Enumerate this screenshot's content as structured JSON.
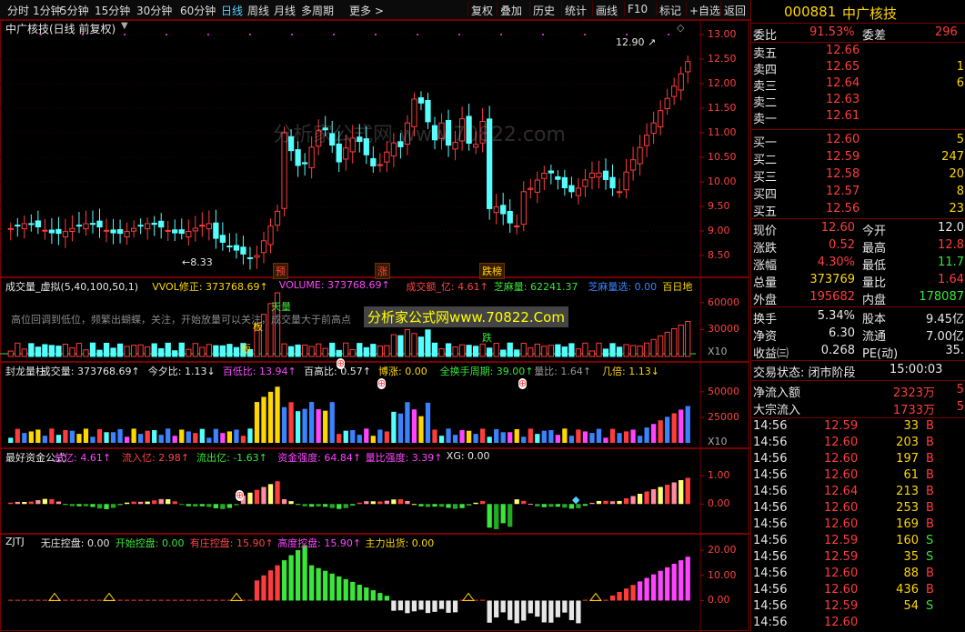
{
  "toolbar": {
    "left": [
      "分时",
      "1分钟",
      "5分钟",
      "15分钟",
      "30分钟",
      "60分钟",
      "日线",
      "周线",
      "月线",
      "多周期",
      "更多 >"
    ],
    "active": "日线",
    "right": [
      "复权",
      "叠加",
      "历史",
      "统计",
      "画线",
      "F10",
      "标记",
      "+自选",
      "返回"
    ]
  },
  "main_panel": {
    "title": "中广核技(日线 前复权)",
    "high_label": "12.90",
    "low_label": "8.33",
    "y_ticks": [
      "13.00",
      "12.50",
      "12.00",
      "11.50",
      "11.00",
      "10.50",
      "10.00",
      "9.50",
      "9.00",
      "8.50"
    ],
    "event_tags": [
      "预",
      "涨",
      "跌榜"
    ],
    "watermark": "分析家公式网 www.70822.com"
  },
  "volume_panel": {
    "items": [
      {
        "text": "成交量_虚拟(5,40,100,50,1)",
        "color": "#e6e6e6"
      },
      {
        "text": "VVOL修正: 373768.69↑",
        "color": "#ffd700"
      },
      {
        "text": "VOLUME: 373768.69↑",
        "color": "#ff44ff"
      },
      {
        "text": "成交额_亿: 4.61↑",
        "color": "#ff4444"
      },
      {
        "text": "芝麻量: 62241.37",
        "color": "#39e639"
      },
      {
        "text": "芝麻量选: 0.00",
        "color": "#3b82ff"
      },
      {
        "text": "百日地",
        "color": "#ffd700"
      }
    ],
    "note": "高位回调到低位，频繁出蝴蝶，关注，开始放量可以关注，成交量大于前高点",
    "ad_text": "分析家公式网www.70822.Com",
    "y_ticks": [
      "60000",
      "30000"
    ],
    "unit": "X10",
    "labels": [
      "板",
      "板",
      "天量",
      "跌"
    ]
  },
  "fenglong_panel": {
    "items": [
      {
        "text": "封龙量柱",
        "color": "#e6e6e6"
      },
      {
        "text": "成交量: 373768.69↑",
        "color": "#e6e6e6"
      },
      {
        "text": "今夕比: 1.13↓",
        "color": "#e6e6e6"
      },
      {
        "text": "百低比: 13.94↑",
        "color": "#ff44ff"
      },
      {
        "text": "百高比: 0.57↑",
        "color": "#e6e6e6"
      },
      {
        "text": "博涨: 0.00",
        "color": "#ffd700"
      },
      {
        "text": "全换手周期: 39.00↑",
        "color": "#39e639"
      },
      {
        "text": "量比: 1.64↑",
        "color": "#999999"
      },
      {
        "text": "几倍: 1.13↓",
        "color": "#ffd700"
      }
    ],
    "y_ticks": [
      "50000",
      "25000"
    ],
    "unit": "X10"
  },
  "fund_panel": {
    "items": [
      {
        "text": "最好资金公式",
        "color": "#e6e6e6"
      },
      {
        "text": "总亿: 4.61↑",
        "color": "#ff44ff"
      },
      {
        "text": "流入亿: 2.98↑",
        "color": "#ff4444"
      },
      {
        "text": "流出亿: -1.63↑",
        "color": "#39e639"
      },
      {
        "text": "资金强度: 64.84↑",
        "color": "#ff44ff"
      },
      {
        "text": "量比强度: 3.39↑",
        "color": "#ff44ff"
      },
      {
        "text": "XG: 0.00",
        "color": "#e6e6e6"
      }
    ],
    "y_ticks": [
      "1.00",
      "0.00"
    ]
  },
  "zjtj_panel": {
    "items": [
      {
        "text": "ZJTJ",
        "color": "#e6e6e6"
      },
      {
        "text": "无庄控盘: 0.00",
        "color": "#e6e6e6"
      },
      {
        "text": "开始控盘: 0.00",
        "color": "#39e639"
      },
      {
        "text": "有庄控盘: 15.90↑",
        "color": "#ff4444"
      },
      {
        "text": "高度控盘: 15.90↑",
        "color": "#ff44ff"
      },
      {
        "text": "主力出货: 0.00",
        "color": "#ffd700"
      }
    ],
    "y_ticks": [
      "20.00",
      "10.00",
      "0.00"
    ]
  },
  "sidebar": {
    "code": "000881",
    "name": "中广核技",
    "weibi_label": "委比",
    "weibi_value": "91.53%",
    "weicha_label": "委差",
    "weicha_value": "296",
    "asks": [
      {
        "label": "卖五",
        "price": "12.66",
        "vol": ""
      },
      {
        "label": "卖四",
        "price": "12.65",
        "vol": "1"
      },
      {
        "label": "卖三",
        "price": "12.64",
        "vol": "6"
      },
      {
        "label": "卖二",
        "price": "12.63",
        "vol": ""
      },
      {
        "label": "卖一",
        "price": "12.61",
        "vol": ""
      }
    ],
    "bids": [
      {
        "label": "买一",
        "price": "12.60",
        "vol": "5"
      },
      {
        "label": "买二",
        "price": "12.59",
        "vol": "247"
      },
      {
        "label": "买三",
        "price": "12.58",
        "vol": "20"
      },
      {
        "label": "买四",
        "price": "12.57",
        "vol": "8"
      },
      {
        "label": "买五",
        "price": "12.56",
        "vol": "23"
      }
    ],
    "quotes": [
      {
        "l1": "现价",
        "v1": "12.60",
        "c1": "red",
        "l2": "今开",
        "v2": "12.0",
        "c2": "white"
      },
      {
        "l1": "涨跌",
        "v1": "0.52",
        "c1": "red",
        "l2": "最高",
        "v2": "12.8",
        "c2": "red"
      },
      {
        "l1": "涨幅",
        "v1": "4.30%",
        "c1": "red",
        "l2": "最低",
        "v2": "11.7",
        "c2": "green"
      },
      {
        "l1": "总量",
        "v1": "373769",
        "c1": "yellow",
        "l2": "量比",
        "v2": "1.64",
        "c2": "red"
      },
      {
        "l1": "外盘",
        "v1": "195682",
        "c1": "red",
        "l2": "内盘",
        "v2": "178087",
        "c2": "green"
      }
    ],
    "stats": [
      {
        "l1": "换手",
        "v1": "5.34%",
        "l2": "股本",
        "v2": "9.45亿"
      },
      {
        "l1": "净资",
        "v1": "6.30",
        "l2": "流通",
        "v2": "7.00亿"
      },
      {
        "l1": "收益㈢",
        "v1": "0.268",
        "l2": "PE(动)",
        "v2": "35."
      }
    ],
    "status_label": "交易状态: 闭市阶段",
    "status_time": "15:00:03",
    "flow": [
      {
        "label": "净流入额",
        "value": "2323万",
        "extra": "5"
      },
      {
        "label": "大宗流入",
        "value": "1733万",
        "extra": "5"
      }
    ],
    "ticks": [
      {
        "t": "14:56",
        "p": "12.59",
        "v": "33",
        "s": "B"
      },
      {
        "t": "14:56",
        "p": "12.60",
        "v": "203",
        "s": "B"
      },
      {
        "t": "14:56",
        "p": "12.60",
        "v": "197",
        "s": "B"
      },
      {
        "t": "14:56",
        "p": "12.60",
        "v": "61",
        "s": "B"
      },
      {
        "t": "14:56",
        "p": "12.64",
        "v": "213",
        "s": "B"
      },
      {
        "t": "14:56",
        "p": "12.60",
        "v": "253",
        "s": "B"
      },
      {
        "t": "14:56",
        "p": "12.60",
        "v": "169",
        "s": "B"
      },
      {
        "t": "14:56",
        "p": "12.59",
        "v": "160",
        "s": "S"
      },
      {
        "t": "14:56",
        "p": "12.59",
        "v": "35",
        "s": "S"
      },
      {
        "t": "14:56",
        "p": "12.60",
        "v": "88",
        "s": "B"
      },
      {
        "t": "14:56",
        "p": "12.60",
        "v": "436",
        "s": "B"
      },
      {
        "t": "14:56",
        "p": "12.59",
        "v": "54",
        "s": "S"
      },
      {
        "t": "14:56",
        "p": "12.60",
        "v": "",
        "s": ""
      }
    ]
  },
  "colors": {
    "up": "#ff3c3c",
    "down": "#54ffff",
    "border": "#7a0000",
    "bg": "#000000"
  }
}
